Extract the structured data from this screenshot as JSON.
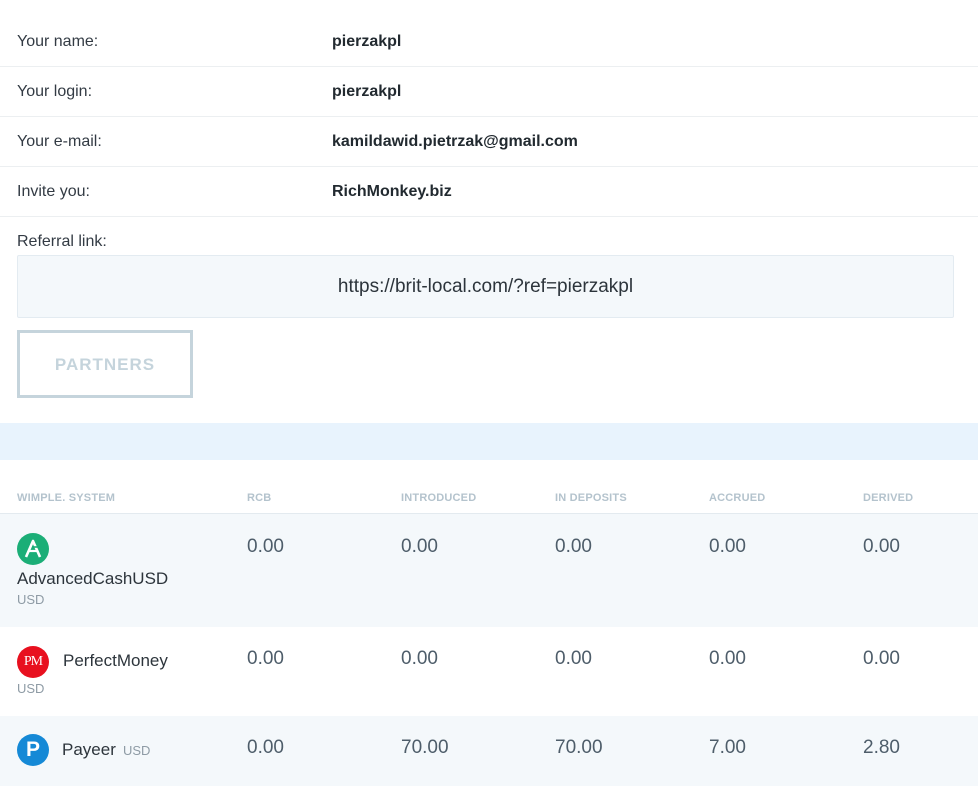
{
  "profile": {
    "rows": [
      {
        "label": "Your name:",
        "value": "pierzakpl"
      },
      {
        "label": "Your login:",
        "value": "pierzakpl"
      },
      {
        "label": "Your e-mail:",
        "value": "kamildawid.pietrzak@gmail.com"
      },
      {
        "label": "Invite you:",
        "value": "RichMonkey.biz"
      }
    ]
  },
  "referral": {
    "label": "Referral link:",
    "link": "https://brit-local.com/?ref=pierzakpl"
  },
  "partners_button": "PARTNERS",
  "table": {
    "headers": [
      "WIMPLE. SYSTEM",
      "RCB",
      "INTRODUCED",
      "IN DEPOSITS",
      "ACCRUED",
      "DERIVED"
    ],
    "rows": [
      {
        "system": "AdvancedCashUSD",
        "currency": "USD",
        "icon": "advcash-icon",
        "rcb": "0.00",
        "introduced": "0.00",
        "in_deposits": "0.00",
        "accrued": "0.00",
        "derived": "0.00"
      },
      {
        "system": "PerfectMoney",
        "currency": "USD",
        "icon": "perfectmoney-icon",
        "icon_text": "PM",
        "rcb": "0.00",
        "introduced": "0.00",
        "in_deposits": "0.00",
        "accrued": "0.00",
        "derived": "0.00"
      },
      {
        "system": "Payeer",
        "currency": "USD",
        "icon": "payeer-icon",
        "icon_text": "P",
        "rcb": "0.00",
        "introduced": "70.00",
        "in_deposits": "70.00",
        "accrued": "7.00",
        "derived": "2.80"
      }
    ]
  },
  "colors": {
    "advcash": "#1bae77",
    "perfectmoney": "#e8101f",
    "payeer": "#1589d6",
    "band": "#e8f3fd"
  }
}
